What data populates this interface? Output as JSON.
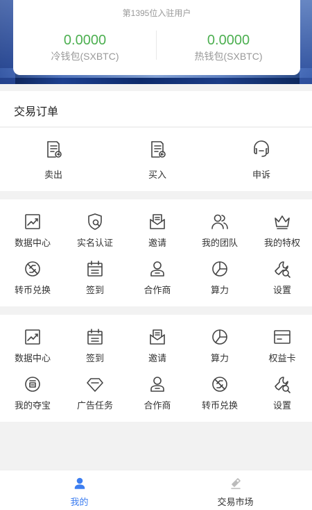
{
  "wallet": {
    "rank_text": "第1395位入驻用户",
    "cold_amount": "0.0000",
    "cold_label": "冷钱包(SXBTC)",
    "hot_amount": "0.0000",
    "hot_label": "热钱包(SXBTC)"
  },
  "orders": {
    "title": "交易订单",
    "items": [
      {
        "label": "卖出",
        "icon": "sell-document-icon"
      },
      {
        "label": "买入",
        "icon": "buy-document-icon"
      },
      {
        "label": "申诉",
        "icon": "headset-icon"
      }
    ]
  },
  "grid1": [
    {
      "label": "数据中心",
      "icon": "chart-icon"
    },
    {
      "label": "实名认证",
      "icon": "shield-check-icon"
    },
    {
      "label": "邀请",
      "icon": "envelope-icon"
    },
    {
      "label": "我的团队",
      "icon": "team-icon"
    },
    {
      "label": "我的特权",
      "icon": "crown-icon"
    },
    {
      "label": "转币兑换",
      "icon": "exchange-icon"
    },
    {
      "label": "签到",
      "icon": "calendar-icon"
    },
    {
      "label": "合作商",
      "icon": "partner-icon"
    },
    {
      "label": "算力",
      "icon": "pie-chart-icon"
    },
    {
      "label": "设置",
      "icon": "wrench-icon"
    }
  ],
  "grid2": [
    {
      "label": "数据中心",
      "icon": "chart-icon"
    },
    {
      "label": "签到",
      "icon": "calendar-icon"
    },
    {
      "label": "邀请",
      "icon": "envelope-icon"
    },
    {
      "label": "算力",
      "icon": "pie-chart-icon"
    },
    {
      "label": "权益卡",
      "icon": "card-icon"
    },
    {
      "label": "我的夺宝",
      "icon": "treasure-icon"
    },
    {
      "label": "广告任务",
      "icon": "diamond-icon"
    },
    {
      "label": "合作商",
      "icon": "partner-icon"
    },
    {
      "label": "转币兑换",
      "icon": "exchange-icon"
    },
    {
      "label": "设置",
      "icon": "wrench-icon"
    }
  ],
  "tabbar": {
    "tabs": [
      {
        "label": "我的",
        "icon": "person-icon",
        "active": true
      },
      {
        "label": "交易市场",
        "icon": "market-icon",
        "active": false
      }
    ],
    "active_color": "#3d7ef0"
  },
  "colors": {
    "amount_green": "#4caf50"
  }
}
